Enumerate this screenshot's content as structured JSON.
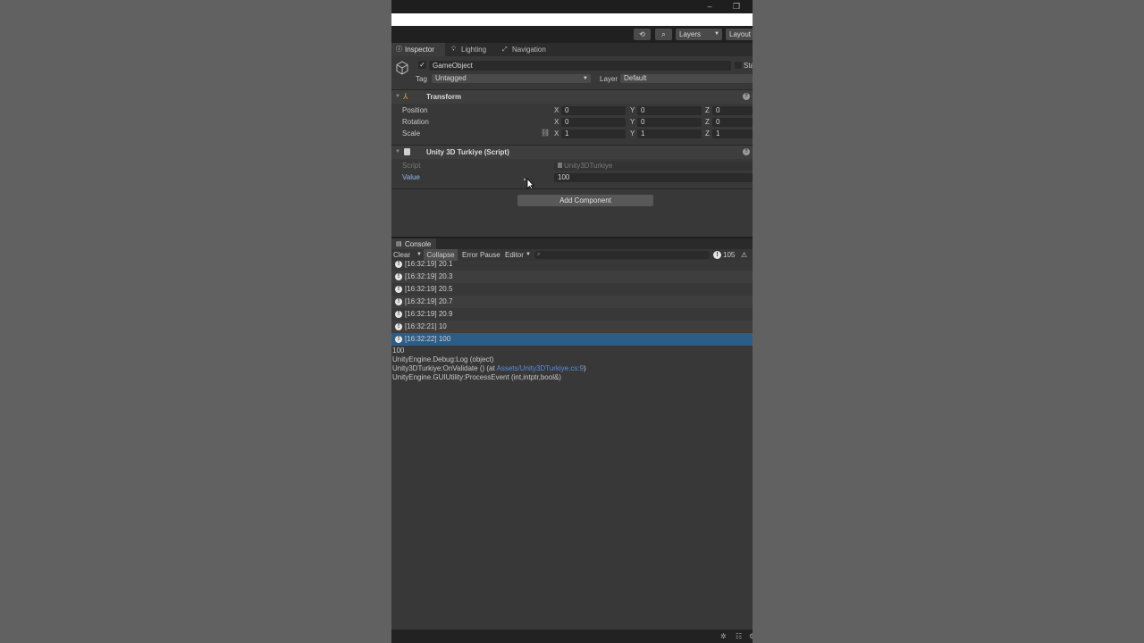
{
  "toolbar": {
    "layers_label": "Layers",
    "layout_label": "Layout"
  },
  "tabs": [
    {
      "label": "Inspector",
      "icon": "info-icon"
    },
    {
      "label": "Lighting",
      "icon": "bulb-icon"
    },
    {
      "label": "Navigation",
      "icon": "navigation-icon"
    }
  ],
  "gameobject": {
    "name": "GameObject",
    "active": true,
    "static_label": "Sta",
    "tag_label": "Tag",
    "tag_value": "Untagged",
    "layer_label": "Layer",
    "layer_value": "Default"
  },
  "transform": {
    "title": "Transform",
    "position": {
      "label": "Position",
      "x": "0",
      "y": "0",
      "z": "0"
    },
    "rotation": {
      "label": "Rotation",
      "x": "0",
      "y": "0",
      "z": "0"
    },
    "scale": {
      "label": "Scale",
      "x": "1",
      "y": "1",
      "z": "1"
    },
    "axis_x": "X",
    "axis_y": "Y",
    "axis_z": "Z"
  },
  "script_component": {
    "title": "Unity 3D Turkiye (Script)",
    "script_label": "Script",
    "script_value": "Unity3DTurkiye",
    "value_label": "Value",
    "value": "100"
  },
  "add_component_label": "Add Component",
  "console": {
    "tab_label": "Console",
    "clear_label": "Clear",
    "collapse_label": "Collapse",
    "error_pause_label": "Error Pause",
    "editor_label": "Editor",
    "log_count": "105",
    "logs": [
      {
        "time": "[16:32:19]",
        "msg": "20.1"
      },
      {
        "time": "[16:32:19]",
        "msg": "20.3"
      },
      {
        "time": "[16:32:19]",
        "msg": "20.5"
      },
      {
        "time": "[16:32:19]",
        "msg": "20.7"
      },
      {
        "time": "[16:32:19]",
        "msg": "20.9"
      },
      {
        "time": "[16:32:21]",
        "msg": "10"
      },
      {
        "time": "[16:32:22]",
        "msg": "100"
      }
    ],
    "detail": {
      "line1": "100",
      "line2": "UnityEngine.Debug:Log (object)",
      "line3_prefix": "Unity3DTurkiye:OnValidate () (at ",
      "line3_link": "Assets/Unity3DTurkiye.cs:9",
      "line3_suffix": ")",
      "line4": "UnityEngine.GUIUtility:ProcessEvent (int,intptr,bool&)"
    }
  },
  "colors": {
    "selection": "#2c5d87",
    "panel": "#383838",
    "link": "#5c8ddd"
  }
}
